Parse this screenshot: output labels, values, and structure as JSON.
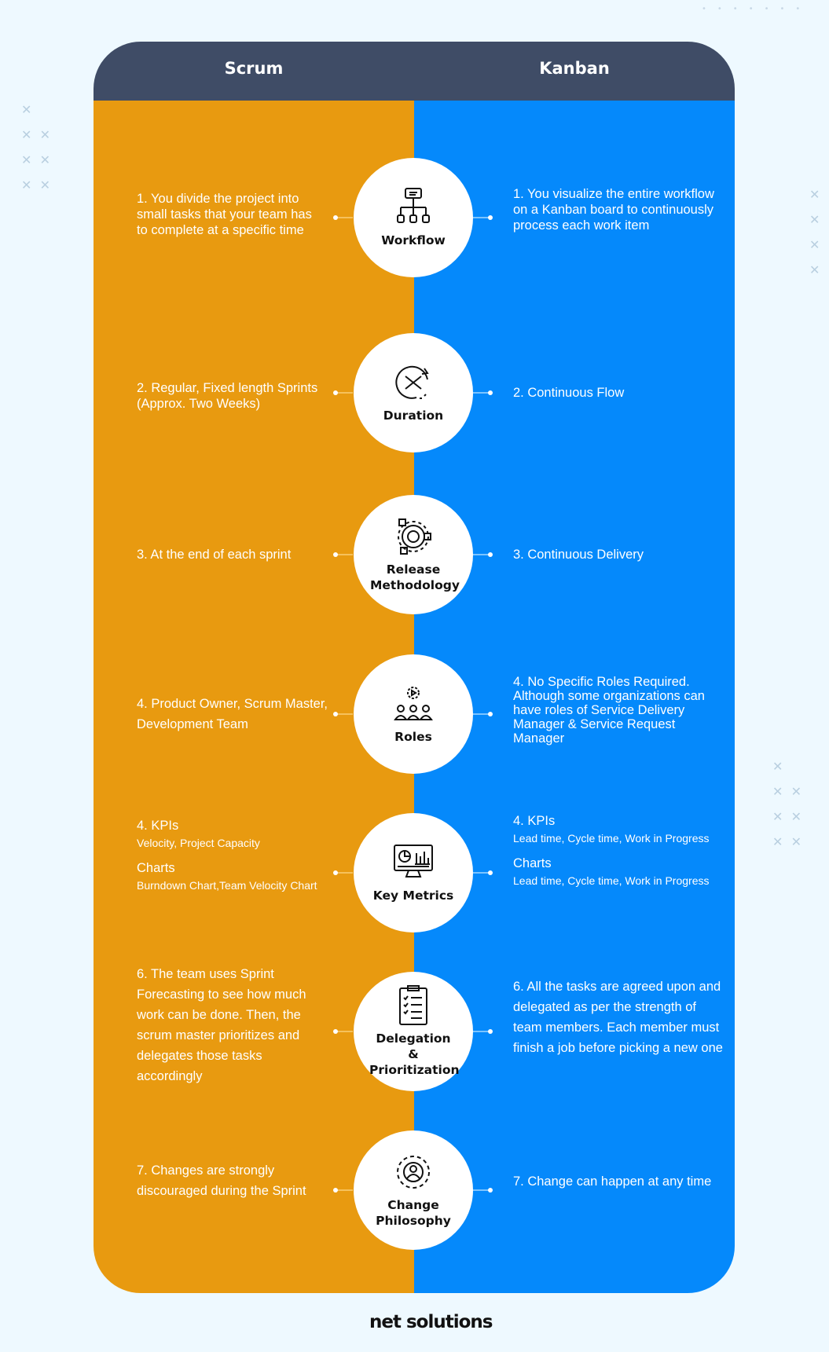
{
  "header": {
    "left": "Scrum",
    "right": "Kanban"
  },
  "rows": [
    {
      "label": "Workflow",
      "icon": "hierarchy-icon",
      "scrum": "1. You divide the project into small tasks that your team has to complete at a specific time",
      "kanban": "1. You visualize the entire workflow on a Kanban board to continuously process each work item"
    },
    {
      "label": "Duration",
      "icon": "hourglass-clock-icon",
      "scrum": "2. Regular, Fixed length Sprints (Approx. Two Weeks)",
      "kanban": "2. Continuous Flow"
    },
    {
      "label": "Release Methodology",
      "icon": "gear-check-icon",
      "scrum": "3. At the end of each sprint",
      "kanban": "3. Continuous Delivery"
    },
    {
      "label": "Roles",
      "icon": "team-gear-icon",
      "scrum": "4. Product Owner, Scrum Master, Development Team",
      "kanban": "4. No Specific Roles Required. Although some organizations can have roles of Service Delivery Manager & Service Request Manager"
    },
    {
      "label": "Key Metrics",
      "icon": "dashboard-monitor-icon",
      "scrum_kpi": "4. KPIs",
      "scrum_kpi_detail": "Velocity, Project Capacity",
      "scrum_charts": "Charts",
      "scrum_charts_detail": "Burndown Chart,Team Velocity Chart",
      "kanban_kpi": "4. KPIs",
      "kanban_kpi_detail": "Lead time, Cycle time, Work in Progress",
      "kanban_charts": "Charts",
      "kanban_charts_detail": "Lead time, Cycle time, Work in Progress"
    },
    {
      "label": "Delegation & Prioritization",
      "icon": "checklist-icon",
      "scrum": "6. The team uses Sprint Forecasting to see how much work can be done. Then, the scrum master prioritizes and delegates those tasks accordingly",
      "kanban": "6. All the tasks are agreed upon and delegated as per the strength of team members. Each member must finish a job before picking a new one"
    },
    {
      "label": "Change Philosophy",
      "icon": "person-cycle-icon",
      "scrum": "7. Changes are strongly discouraged during the Sprint",
      "kanban": "7. Change can happen at any time"
    }
  ],
  "footer": {
    "logo": "net solutions"
  },
  "colors": {
    "header": "#3f4c66",
    "scrum": "#e89a10",
    "kanban": "#0589fb",
    "background": "#eef9ff"
  }
}
